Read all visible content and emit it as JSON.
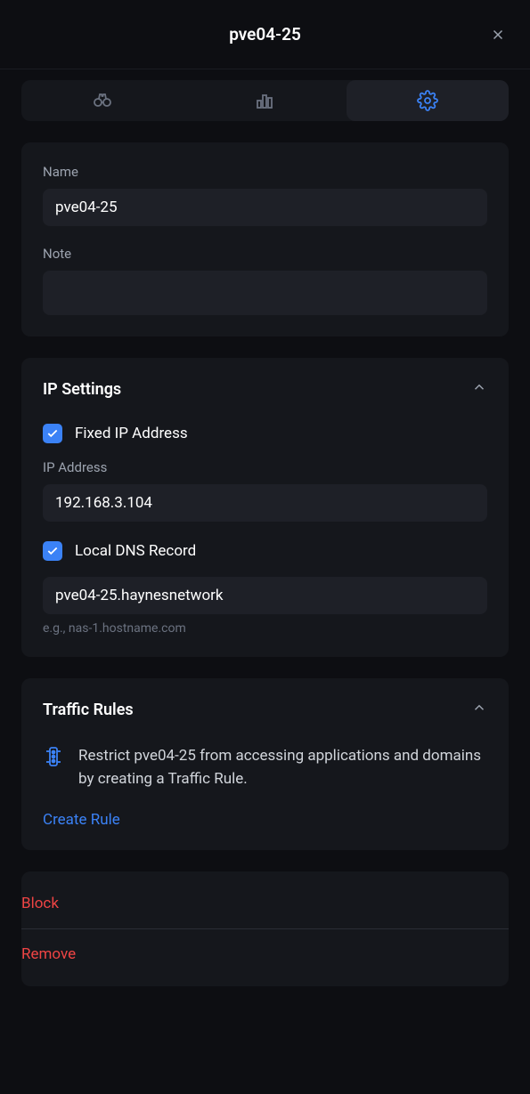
{
  "header": {
    "title": "pve04-25"
  },
  "tabs": {
    "active_index": 2
  },
  "general": {
    "name_label": "Name",
    "name_value": "pve04-25",
    "note_label": "Note",
    "note_value": ""
  },
  "ip": {
    "section_title": "IP Settings",
    "fixed_ip_label": "Fixed IP Address",
    "fixed_ip_checked": true,
    "ip_address_label": "IP Address",
    "ip_address_value": "192.168.3.104",
    "local_dns_label": "Local DNS Record",
    "local_dns_checked": true,
    "dns_value": "pve04-25.haynesnetwork",
    "dns_hint": "e.g., nas-1.hostname.com"
  },
  "traffic": {
    "section_title": "Traffic Rules",
    "description": "Restrict pve04-25 from accessing applications and domains by creating a Traffic Rule.",
    "create_label": "Create Rule"
  },
  "actions": {
    "block_label": "Block",
    "remove_label": "Remove"
  }
}
